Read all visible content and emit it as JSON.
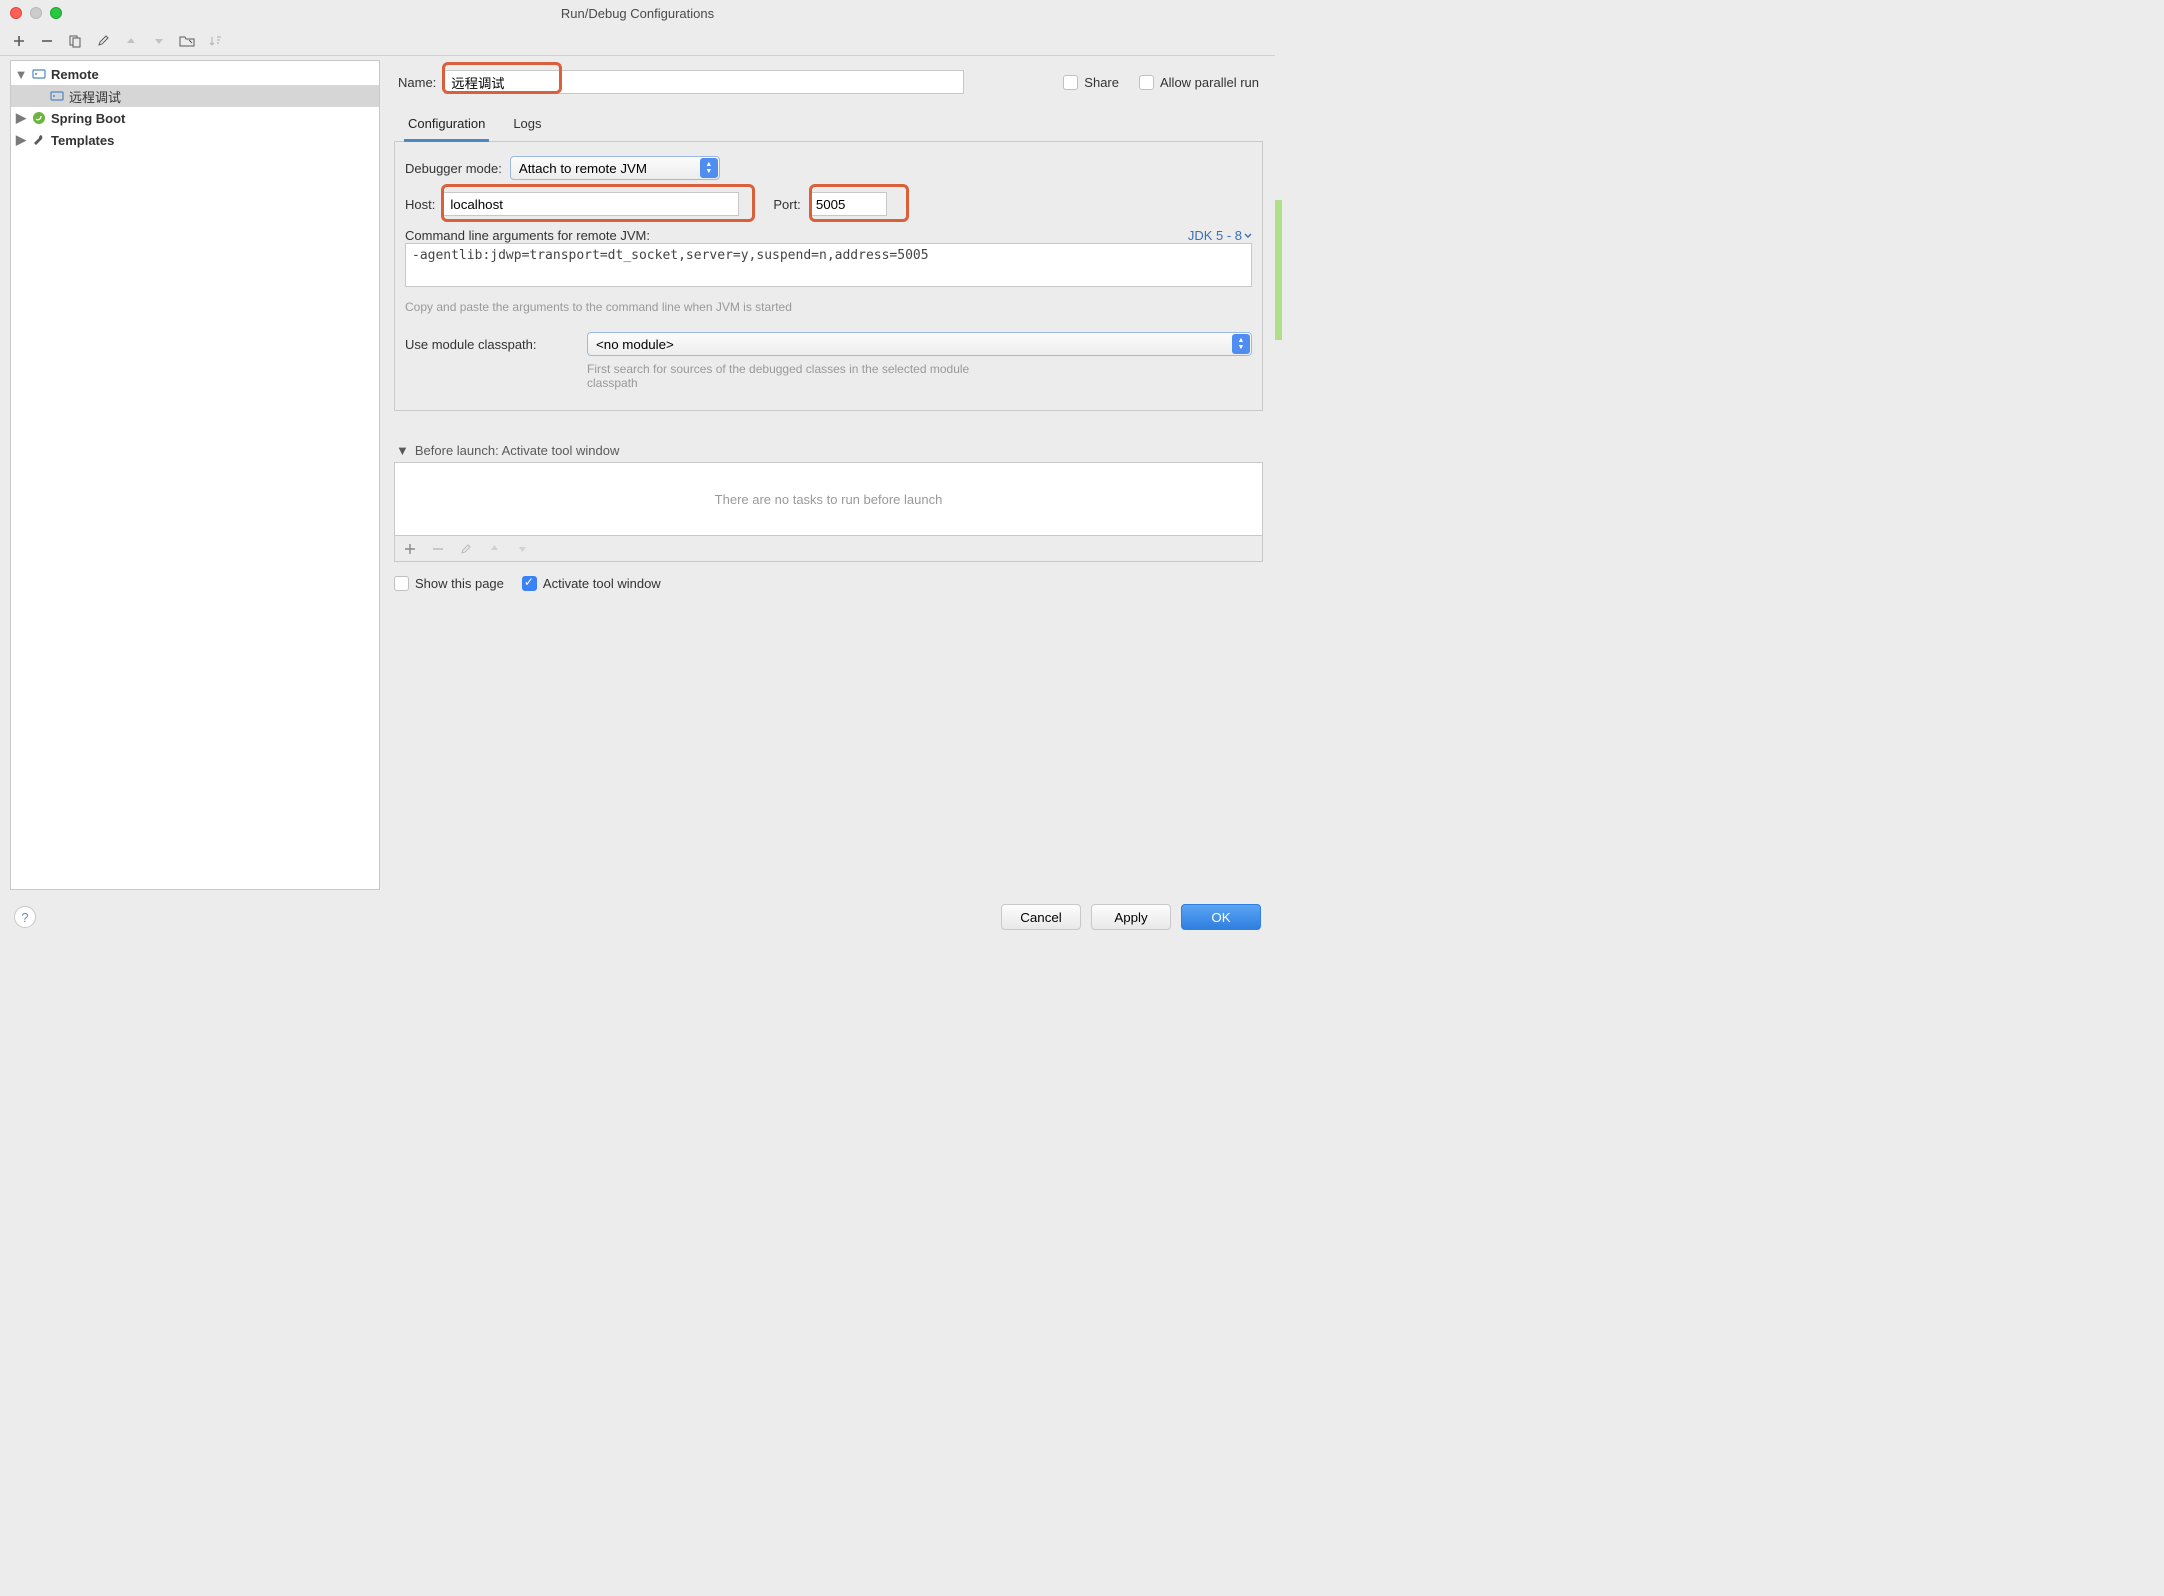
{
  "window": {
    "title": "Run/Debug Configurations"
  },
  "sidebar": {
    "items": [
      {
        "label": "Remote",
        "expanded": true
      },
      {
        "label": "远程调试",
        "selected": true
      },
      {
        "label": "Spring Boot",
        "expanded": false
      },
      {
        "label": "Templates",
        "expanded": false
      }
    ]
  },
  "header": {
    "name_label": "Name:",
    "name_value": "远程调试",
    "share_label": "Share",
    "parallel_label": "Allow parallel run"
  },
  "tabs": {
    "configuration": "Configuration",
    "logs": "Logs"
  },
  "config": {
    "debugger_mode_label": "Debugger mode:",
    "debugger_mode_value": "Attach to remote JVM",
    "host_label": "Host:",
    "host_value": "localhost",
    "port_label": "Port:",
    "port_value": "5005",
    "cmd_label": "Command line arguments for remote JVM:",
    "jdk_label": "JDK 5 - 8",
    "cmd_value": "-agentlib:jdwp=transport=dt_socket,server=y,suspend=n,address=5005",
    "cmd_hint": "Copy and paste the arguments to the command line when JVM is started",
    "module_label": "Use module classpath:",
    "module_value": "<no module>",
    "module_hint": "First search for sources of the debugged classes in the selected module classpath"
  },
  "before": {
    "title": "Before launch: Activate tool window",
    "empty": "There are no tasks to run before launch",
    "show_page": "Show this page",
    "activate": "Activate tool window"
  },
  "footer": {
    "cancel": "Cancel",
    "apply": "Apply",
    "ok": "OK"
  }
}
